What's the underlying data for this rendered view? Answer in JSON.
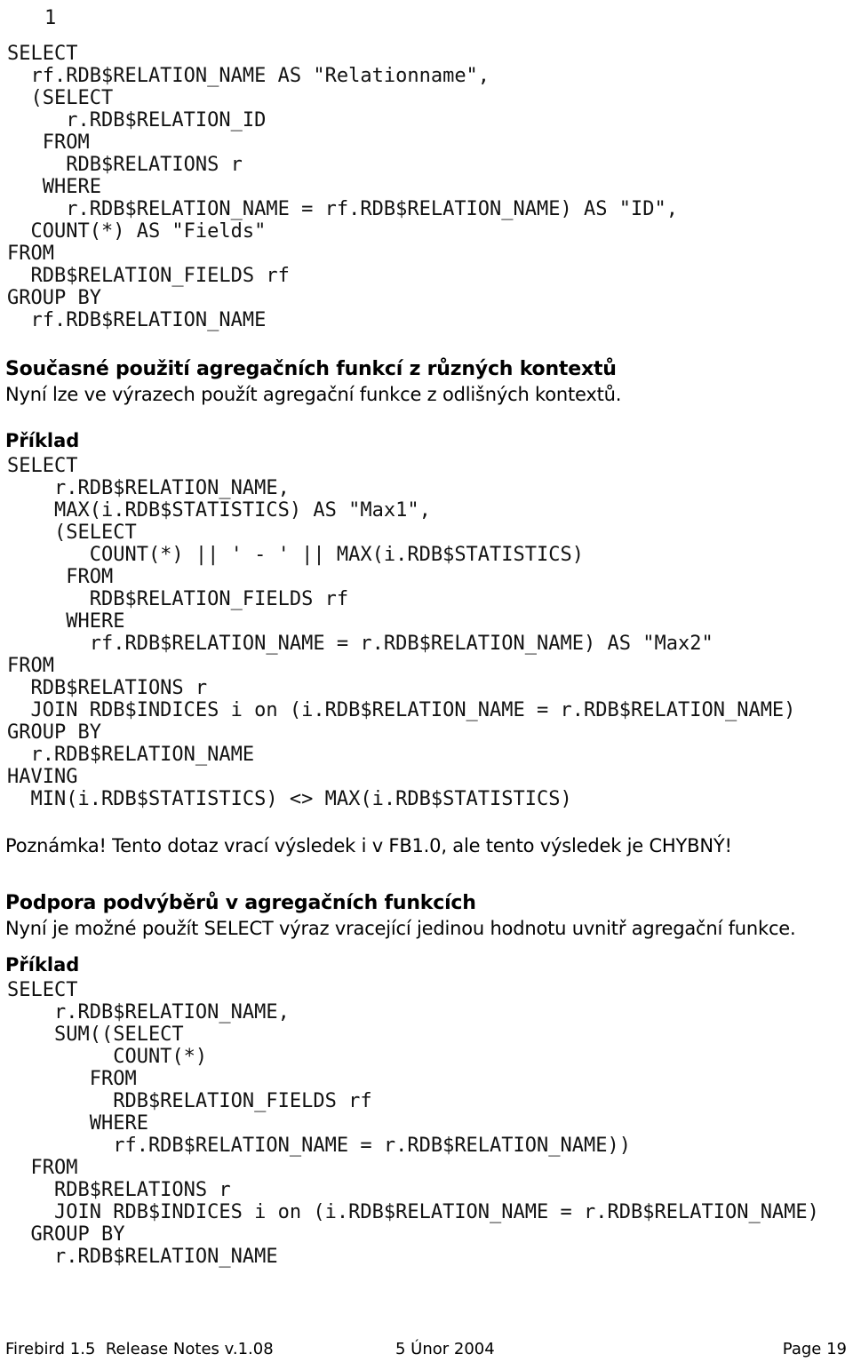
{
  "document": {
    "page_number_top": "1",
    "code_block_1": "SELECT\n  rf.RDB$RELATION_NAME AS \"Relationname\",\n  (SELECT\n     r.RDB$RELATION_ID\n   FROM\n     RDB$RELATIONS r\n   WHERE\n     r.RDB$RELATION_NAME = rf.RDB$RELATION_NAME) AS \"ID\",\n  COUNT(*) AS \"Fields\"\nFROM\n  RDB$RELATION_FIELDS rf\nGROUP BY\n  rf.RDB$RELATION_NAME",
    "heading_1": "Současné použití agregačních funkcí z různých kontextů",
    "body_1": "Nyní lze ve výrazech použít agregační funkce z odlišných kontextů.",
    "example_label_1": "Příklad",
    "code_block_2": "SELECT\n    r.RDB$RELATION_NAME,\n    MAX(i.RDB$STATISTICS) AS \"Max1\",\n    (SELECT\n       COUNT(*) || ' - ' || MAX(i.RDB$STATISTICS)\n     FROM\n       RDB$RELATION_FIELDS rf\n     WHERE\n       rf.RDB$RELATION_NAME = r.RDB$RELATION_NAME) AS \"Max2\"\nFROM\n  RDB$RELATIONS r\n  JOIN RDB$INDICES i on (i.RDB$RELATION_NAME = r.RDB$RELATION_NAME)\nGROUP BY\n  r.RDB$RELATION_NAME\nHAVING\n  MIN(i.RDB$STATISTICS) <> MAX(i.RDB$STATISTICS)",
    "note_1": "Poznámka! Tento dotaz vrací výsledek i v FB1.0, ale tento výsledek je CHYBNÝ!",
    "heading_2": "Podpora podvýběrů v agregačních funkcích",
    "body_2": "Nyní je možné použít SELECT výraz vracející jedinou hodnotu uvnitř agregační funkce.",
    "example_label_2": "Příklad",
    "code_block_3": "SELECT\n    r.RDB$RELATION_NAME,\n    SUM((SELECT\n         COUNT(*)\n       FROM\n         RDB$RELATION_FIELDS rf\n       WHERE\n         rf.RDB$RELATION_NAME = r.RDB$RELATION_NAME))\n  FROM\n    RDB$RELATIONS r\n    JOIN RDB$INDICES i on (i.RDB$RELATION_NAME = r.RDB$RELATION_NAME)\n  GROUP BY\n    r.RDB$RELATION_NAME"
  },
  "footer": {
    "left": "Firebird 1.5  Release Notes v.1.08",
    "center": "5 Únor 2004",
    "right": "Page 19"
  },
  "colors": {
    "page_background": "#ffffff",
    "text": "#000000",
    "code_text": "#121212"
  }
}
